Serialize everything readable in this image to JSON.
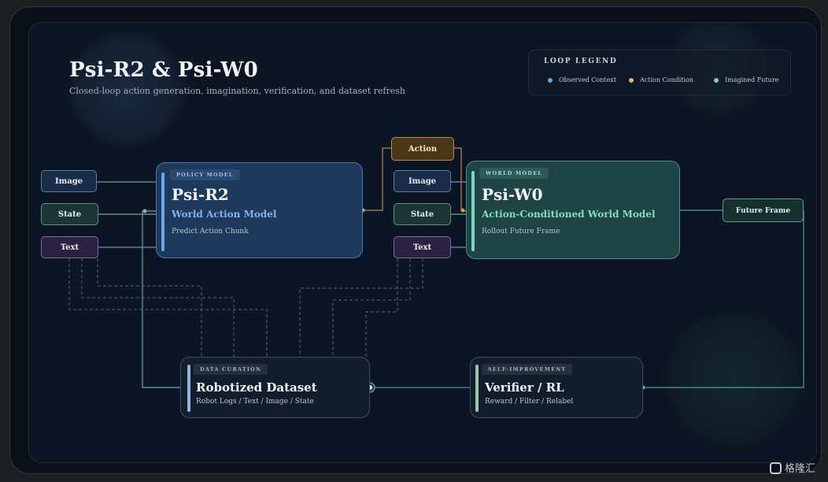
{
  "title": "Psi-R2 & Psi-W0",
  "subtitle": "Closed-loop action generation, imagination, verification, and dataset refresh",
  "legend": {
    "title": "LOOP LEGEND",
    "items": [
      {
        "label": "Observed Context",
        "color": "#5fa4e8"
      },
      {
        "label": "Action Condition",
        "color": "#e3b46a"
      },
      {
        "label": "Imagined Future",
        "color": "#6fd3bf"
      }
    ]
  },
  "inputs_left": {
    "image": "Image",
    "state": "State",
    "text": "Text"
  },
  "inputs_right": {
    "image": "Image",
    "state": "State",
    "text": "Text"
  },
  "action": "Action",
  "future_frame": "Future Frame",
  "policy": {
    "tag": "POLICY MODEL",
    "title": "Psi-R2",
    "subtitle": "World Action Model",
    "desc": "Predict Action Chunk"
  },
  "world": {
    "tag": "WORLD MODEL",
    "title": "Psi-W0",
    "subtitle": "Action-Conditioned World Model",
    "desc": "Rollout Future Frame"
  },
  "dataset": {
    "tag": "DATA CURATION",
    "title": "Robotized Dataset",
    "desc": "Robot Logs / Text / Image / State"
  },
  "verifier": {
    "tag": "SELF-IMPROVEMENT",
    "title": "Verifier / RL",
    "desc": "Reward / Filter / Relabel"
  },
  "watermark": "格隆汇",
  "colors": {
    "observed": "#5fa4e8",
    "action": "#e3b46a",
    "imagined": "#6fd3bf"
  }
}
